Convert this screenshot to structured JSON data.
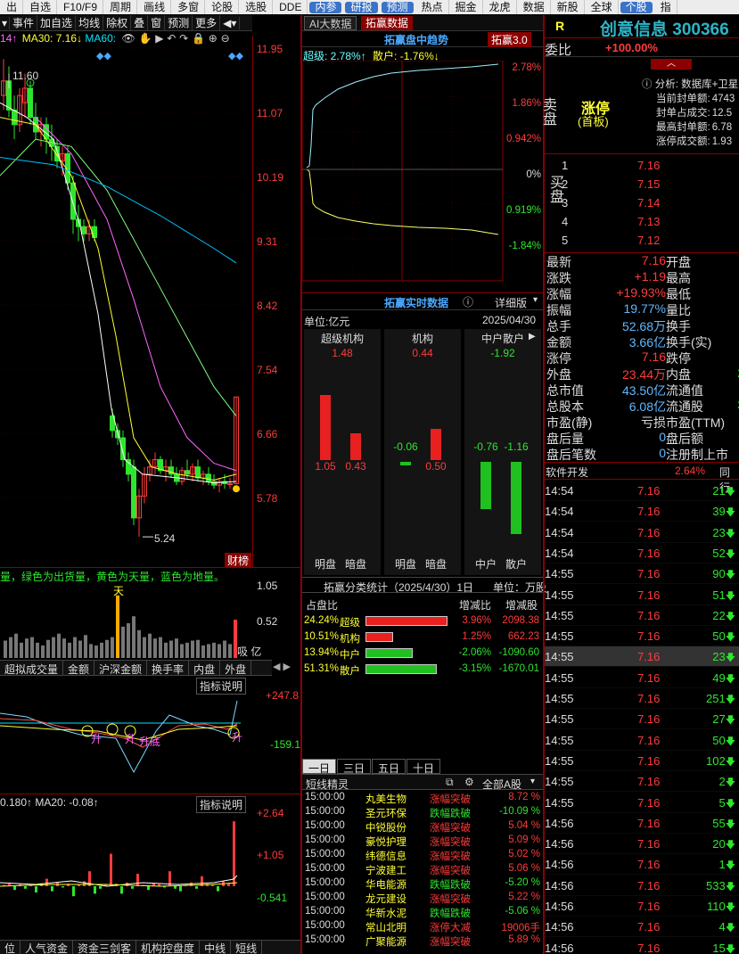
{
  "menu": [
    "出",
    "自选",
    "F10/F9",
    "周期",
    "画线",
    "多窗",
    "论股",
    "选股",
    "DDE",
    "内参",
    "研报",
    "预测",
    "热点",
    "掘金",
    "龙虎",
    "数据",
    "新股",
    "全球",
    "个股",
    "指"
  ],
  "left_toolbar": [
    "事件",
    "加自选",
    "均线",
    "除权",
    "叠",
    "窗",
    "预测",
    "更多"
  ],
  "ma_line": {
    "a": "14↑",
    "b": "MA30: 7.16↓",
    "c": "MA60:"
  },
  "kline": {
    "price_axis": [
      "11.95",
      "11.07",
      "10.19",
      "9.31",
      "8.42",
      "7.54",
      "6.66",
      "5.78"
    ],
    "high_label": "11.60",
    "low_label": "5.24",
    "board_label": "财榜"
  },
  "volume": {
    "legend": "量，绿色为出货量，黄色为天量，蓝色为地量。",
    "tian_label": "天",
    "axis": [
      "1.05",
      "0.52"
    ],
    "corner": "吸 亿"
  },
  "ind_tabs": [
    "超拟成交量",
    "金额",
    "沪深金额",
    "换手率",
    "内盘",
    "外盘"
  ],
  "ind1": {
    "help": "指标说明",
    "axis_top": "+247.8",
    "axis_bot": "-159.1",
    "marks": [
      "升",
      "升",
      "升底",
      "升"
    ]
  },
  "ind2": {
    "legend": "0.180↑ MA20: -0.08↑",
    "help": "指标说明",
    "axis": [
      "+2.64",
      "+1.05",
      "-0.541"
    ]
  },
  "bottom_tabs": [
    "位",
    "人气资金",
    "资金三剑客",
    "机构控盘度",
    "中线",
    "短线"
  ],
  "mid_tabs": {
    "tab1": "AI大数据",
    "tab2": "拓赢数据"
  },
  "intraday": {
    "title": "拓赢盘中趋势",
    "badge": "拓赢3.0",
    "super_label": "超级: 2.78%↑",
    "retail_label": "散户: -1.76%↓",
    "axis": [
      "2.78%",
      "1.86%",
      "0.942%",
      "0%",
      "0.919%",
      "-1.84%"
    ]
  },
  "realtime": {
    "title": "拓赢实时数据",
    "detail": "详细版",
    "unit": "单位:亿元",
    "date": "2025/04/30",
    "groups": [
      {
        "name": "超级机构",
        "total": "1.48",
        "left_val": "1.05",
        "right_val": "0.43",
        "left_lbl": "明盘",
        "right_lbl": "暗盘",
        "left_num": 1.05,
        "right_num": 0.43
      },
      {
        "name": "机构",
        "total": "0.44",
        "left_val": "-0.06",
        "right_val": "0.50",
        "left_lbl": "明盘",
        "right_lbl": "暗盘",
        "left_num": -0.06,
        "right_num": 0.5
      },
      {
        "name": "中户散户",
        "total": "-1.92",
        "left_val": "-0.76",
        "right_val": "-1.16",
        "left_lbl": "中户",
        "right_lbl": "散户",
        "left_num": -0.76,
        "right_num": -1.16
      }
    ]
  },
  "classify": {
    "title": "拓赢分类统计（2025/4/30）1日",
    "unit": "单位：万股",
    "col1": "占盘比",
    "col2": "增减比",
    "col3": "增减股",
    "rows": [
      {
        "pct": "24.24%",
        "name": "超级",
        "chg": "3.96%",
        "shares": "2098.38",
        "bar": 0.9,
        "color": "#e82020"
      },
      {
        "pct": "10.51%",
        "name": "机构",
        "chg": "1.25%",
        "shares": "662.23",
        "bar": 0.3,
        "color": "#e82020"
      },
      {
        "pct": "13.94%",
        "name": "中户",
        "chg": "-2.06%",
        "shares": "-1090.60",
        "bar": 0.52,
        "color": "#20c020"
      },
      {
        "pct": "51.31%",
        "name": "散户",
        "chg": "-3.15%",
        "shares": "-1670.01",
        "bar": 0.78,
        "color": "#20c020"
      }
    ]
  },
  "period_tabs": [
    "一日",
    "三日",
    "五日",
    "十日"
  ],
  "signals": {
    "title": "短线精灵",
    "filter": "全部A股",
    "rows": [
      {
        "time": "15:00:00",
        "name": "丸美生物",
        "type": "涨幅突破",
        "val": "8.72 %",
        "up": true
      },
      {
        "time": "15:00:00",
        "name": "圣元环保",
        "type": "跌幅跌破",
        "val": "-10.09 %",
        "up": false
      },
      {
        "time": "15:00:00",
        "name": "中锐股份",
        "type": "涨幅突破",
        "val": "5.04 %",
        "up": true
      },
      {
        "time": "15:00:00",
        "name": "豪悦护理",
        "type": "涨幅突破",
        "val": "5.09 %",
        "up": true
      },
      {
        "time": "15:00:00",
        "name": "纬德信息",
        "type": "涨幅突破",
        "val": "5.02 %",
        "up": true
      },
      {
        "time": "15:00:00",
        "name": "宁波建工",
        "type": "涨幅突破",
        "val": "5.06 %",
        "up": true
      },
      {
        "time": "15:00:00",
        "name": "华电能源",
        "type": "跌幅跌破",
        "val": "-5.20 %",
        "up": false
      },
      {
        "time": "15:00:00",
        "name": "龙元建设",
        "type": "涨幅突破",
        "val": "5.22 %",
        "up": true
      },
      {
        "time": "15:00:00",
        "name": "华新水泥",
        "type": "跌幅跌破",
        "val": "-5.06 %",
        "up": false
      },
      {
        "time": "15:00:00",
        "name": "常山北明",
        "type": "涨停大减",
        "val": "19006手",
        "up": true
      },
      {
        "time": "15:00:00",
        "name": "广聚能源",
        "type": "涨幅突破",
        "val": "5.89 %",
        "up": true
      }
    ]
  },
  "stock": {
    "r": "R",
    "name": "创意信息 300366",
    "webi_label": "委比",
    "webi": "+100.00%",
    "sell_label": "卖盘",
    "buy_label": "买盘",
    "limit": "涨停",
    "limit_sub": "(首板)",
    "analysis": "分析: 数据库+卫星",
    "seal_info": [
      {
        "k": "当前封单额:",
        "v": "4743"
      },
      {
        "k": "封单占成交:",
        "v": "12.5"
      },
      {
        "k": "最高封单额:",
        "v": "6.78"
      },
      {
        "k": "涨停成交额:",
        "v": "1.93"
      }
    ],
    "bids": [
      {
        "lvl": "1",
        "price": "7.16"
      },
      {
        "lvl": "2",
        "price": "7.15"
      },
      {
        "lvl": "3",
        "price": "7.14"
      },
      {
        "lvl": "4",
        "price": "7.13"
      },
      {
        "lvl": "5",
        "price": "7.12"
      }
    ]
  },
  "quote": [
    {
      "l": "最新",
      "v": "7.16",
      "c": "red",
      "r": "开盘"
    },
    {
      "l": "涨跌",
      "v": "+1.19",
      "c": "red",
      "r": "最高"
    },
    {
      "l": "涨幅",
      "v": "+19.93%",
      "c": "red",
      "r": "最低"
    },
    {
      "l": "振幅",
      "v": "19.77%",
      "c": "cyan",
      "r": "量比"
    },
    {
      "l": "总手",
      "v": "52.68万",
      "c": "cyan",
      "r": "换手"
    },
    {
      "l": "金额",
      "v": "3.66亿",
      "c": "cyan",
      "r": "换手(实)"
    },
    {
      "l": "涨停",
      "v": "7.16",
      "c": "red",
      "r": "跌停"
    },
    {
      "l": "外盘",
      "v": "23.44万",
      "c": "red",
      "r": "内盘"
    },
    {
      "l": "总市值",
      "v": "43.50亿",
      "c": "cyan",
      "r": "流通值"
    },
    {
      "l": "总股本",
      "v": "6.08亿",
      "c": "cyan",
      "r": "流通股"
    },
    {
      "l": "市盈(静)",
      "v": "亏损",
      "c": "wht",
      "r": "市盈(TTM)"
    },
    {
      "l": "盘后量",
      "v": "0",
      "c": "cyan",
      "r": "盘后额"
    },
    {
      "l": "盘后笔数",
      "v": "0",
      "c": "cyan",
      "r": "注册制上市"
    }
  ],
  "quote_right_vals": [
    "",
    "",
    "",
    "",
    "",
    "",
    "",
    "2",
    "",
    "3",
    "",
    "",
    ""
  ],
  "sector": {
    "name": "软件开发",
    "pct": "2.64%",
    "tail": "同行"
  },
  "ticks": [
    {
      "t": "14:54",
      "p": "7.16",
      "v": "21"
    },
    {
      "t": "14:54",
      "p": "7.16",
      "v": "39"
    },
    {
      "t": "14:54",
      "p": "7.16",
      "v": "23"
    },
    {
      "t": "14:54",
      "p": "7.16",
      "v": "52"
    },
    {
      "t": "14:55",
      "p": "7.16",
      "v": "90"
    },
    {
      "t": "14:55",
      "p": "7.16",
      "v": "51"
    },
    {
      "t": "14:55",
      "p": "7.16",
      "v": "22"
    },
    {
      "t": "14:55",
      "p": "7.16",
      "v": "50"
    },
    {
      "t": "14:55",
      "p": "7.16",
      "v": "23"
    },
    {
      "t": "14:55",
      "p": "7.16",
      "v": "49"
    },
    {
      "t": "14:55",
      "p": "7.16",
      "v": "251"
    },
    {
      "t": "14:55",
      "p": "7.16",
      "v": "27"
    },
    {
      "t": "14:55",
      "p": "7.16",
      "v": "50"
    },
    {
      "t": "14:55",
      "p": "7.16",
      "v": "102"
    },
    {
      "t": "14:55",
      "p": "7.16",
      "v": "2"
    },
    {
      "t": "14:55",
      "p": "7.16",
      "v": "5"
    },
    {
      "t": "14:56",
      "p": "7.16",
      "v": "55"
    },
    {
      "t": "14:56",
      "p": "7.16",
      "v": "20"
    },
    {
      "t": "14:56",
      "p": "7.16",
      "v": "1"
    },
    {
      "t": "14:56",
      "p": "7.16",
      "v": "533"
    },
    {
      "t": "14:56",
      "p": "7.16",
      "v": "110"
    },
    {
      "t": "14:56",
      "p": "7.16",
      "v": "4"
    },
    {
      "t": "14:56",
      "p": "7.16",
      "v": "15"
    }
  ],
  "colors": {
    "up": "#ff3b3b",
    "down": "#2ee62e",
    "accent": "#00e5ff",
    "border": "#8b0000"
  }
}
